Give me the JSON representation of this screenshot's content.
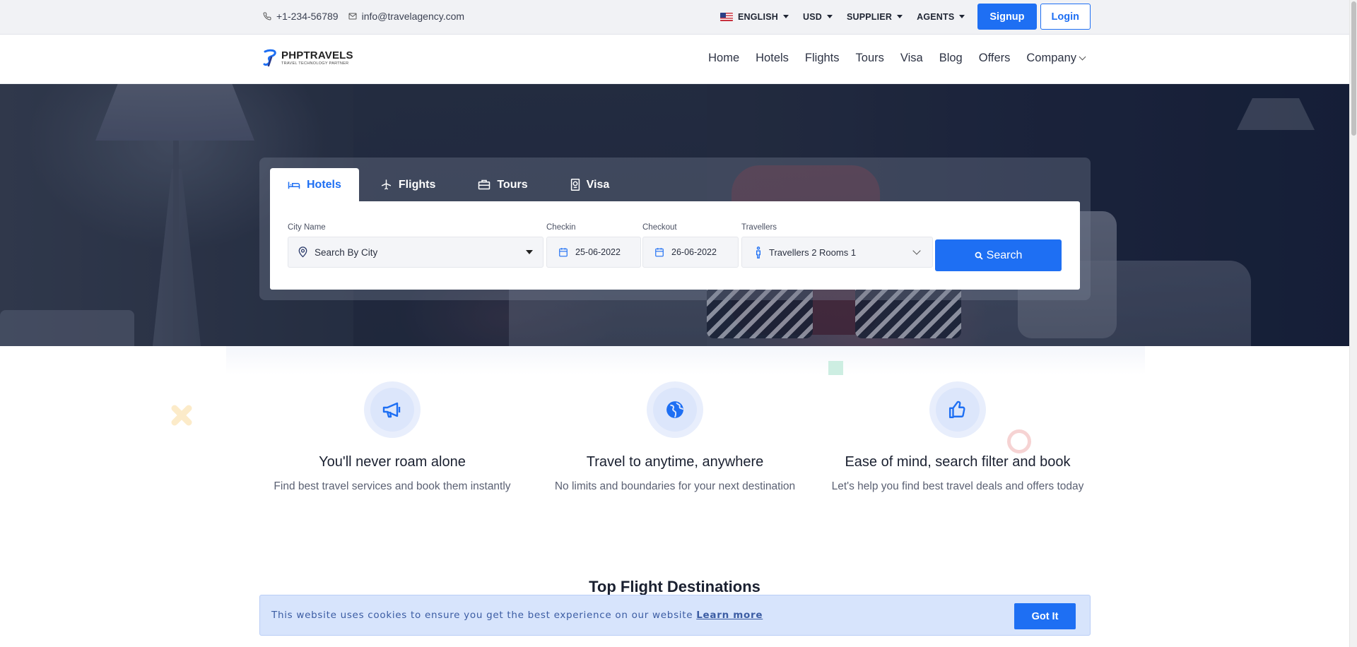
{
  "topbar": {
    "phone": "+1-234-56789",
    "email": "info@travelagency.com",
    "language": "ENGLISH",
    "currency": "USD",
    "supplier": "SUPPLIER",
    "agents": "AGENTS",
    "signup": "Signup",
    "login": "Login"
  },
  "brand": {
    "name": "PHPTRAVELS",
    "tagline": "TRAVEL TECHNOLOGY PARTNER"
  },
  "nav": {
    "items": [
      "Home",
      "Hotels",
      "Flights",
      "Tours",
      "Visa",
      "Blog",
      "Offers",
      "Company"
    ]
  },
  "search": {
    "tabs": [
      "Hotels",
      "Flights",
      "Tours",
      "Visa"
    ],
    "active_tab": "Hotels",
    "city_label": "City Name",
    "city_value": "Search By City",
    "checkin_label": "Checkin",
    "checkin_value": "25-06-2022",
    "checkout_label": "Checkout",
    "checkout_value": "26-06-2022",
    "travellers_label": "Travellers",
    "travellers_value": "Travellers 2 Rooms 1",
    "button": "Search"
  },
  "features": [
    {
      "icon": "megaphone-icon",
      "title": "You'll never roam alone",
      "text": "Find best travel services and book them instantly"
    },
    {
      "icon": "globe-icon",
      "title": "Travel to anytime, anywhere",
      "text": "No limits and boundaries for your next destination"
    },
    {
      "icon": "thumbs-up-icon",
      "title": "Ease of mind, search filter and book",
      "text": "Let's help you find best travel deals and offers today"
    }
  ],
  "section_title": "Top Flight Destinations",
  "cookie": {
    "message": "This website uses cookies to ensure you get the best experience on our website",
    "learn_more": "Learn more",
    "button": "Got It"
  },
  "colors": {
    "primary": "#1e6ff3",
    "topbar_bg": "#f1f2f5",
    "cookie_bg": "#d7e4fc"
  }
}
